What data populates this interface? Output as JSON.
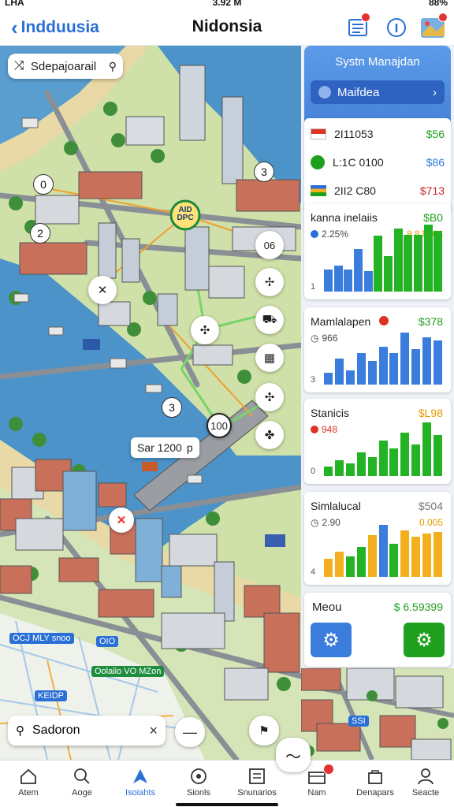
{
  "status_bar": {
    "carrier": "LHA",
    "time": "3.92 M",
    "battery": "88%"
  },
  "header": {
    "back_label": "Indduusia",
    "title": "Nidonsia",
    "notification_count": ""
  },
  "map": {
    "search_chip": "Sdepajoarail",
    "center_marker": "AID DPC",
    "node_labels": [
      "0",
      "2",
      "3",
      "3"
    ],
    "distance_label": "Sar 1200",
    "distance_unit": "p",
    "nodes": {
      "n1": "06",
      "n2": "100"
    },
    "place_labels": [
      "OCJ MLY snoo",
      "OIO",
      "Oolalio VO MZon",
      "KEIDP",
      "SSI"
    ],
    "bottom_search": "Sadoron",
    "bottom_search_clear": "×"
  },
  "panel": {
    "system_title": "Systn Manajdan",
    "system_button": "Maifdea",
    "list": [
      {
        "code": "2I11053",
        "value": "$56",
        "color": "#1ea01e"
      },
      {
        "code": "L:1C 0100",
        "value": "$86",
        "color": "#2a7ad6"
      },
      {
        "code": "2II2 C80",
        "value": "$713",
        "color": "#c62828"
      }
    ],
    "cards": [
      {
        "title": "kanna inelaiis",
        "value": "$B0",
        "sub": "2.25%",
        "sub_value": "8 8J.206",
        "y_label": "1",
        "bars": [
          {
            "v": 0.22,
            "c": "#3b7ddd"
          },
          {
            "v": 0.26,
            "c": "#3b7ddd"
          },
          {
            "v": 0.22,
            "c": "#3b7ddd"
          },
          {
            "v": 0.42,
            "c": "#3b7ddd"
          },
          {
            "v": 0.2,
            "c": "#3b7ddd"
          },
          {
            "v": 0.55,
            "c": "#24b324"
          },
          {
            "v": 0.35,
            "c": "#24b324"
          },
          {
            "v": 0.62,
            "c": "#24b324"
          },
          {
            "v": 0.56,
            "c": "#24b324"
          },
          {
            "v": 0.56,
            "c": "#24b324"
          },
          {
            "v": 0.66,
            "c": "#24b324"
          },
          {
            "v": 0.6,
            "c": "#24b324"
          }
        ]
      },
      {
        "title": "Mamlalapen",
        "value": "$378",
        "sub": "966",
        "sub_value": "",
        "y_label": "3",
        "bars": [
          {
            "v": 0.15,
            "c": "#3b7ddd"
          },
          {
            "v": 0.33,
            "c": "#3b7ddd"
          },
          {
            "v": 0.18,
            "c": "#3b7ddd"
          },
          {
            "v": 0.4,
            "c": "#3b7ddd"
          },
          {
            "v": 0.3,
            "c": "#3b7ddd"
          },
          {
            "v": 0.48,
            "c": "#3b7ddd"
          },
          {
            "v": 0.4,
            "c": "#3b7ddd"
          },
          {
            "v": 0.66,
            "c": "#3b7ddd"
          },
          {
            "v": 0.45,
            "c": "#3b7ddd"
          },
          {
            "v": 0.6,
            "c": "#3b7ddd"
          },
          {
            "v": 0.56,
            "c": "#3b7ddd"
          }
        ]
      },
      {
        "title": "Stanicis",
        "value": "$L98",
        "sub": "948",
        "sub_value": "",
        "y_label": "0",
        "bars": [
          {
            "v": 0.12,
            "c": "#24b324"
          },
          {
            "v": 0.2,
            "c": "#24b324"
          },
          {
            "v": 0.16,
            "c": "#24b324"
          },
          {
            "v": 0.3,
            "c": "#24b324"
          },
          {
            "v": 0.24,
            "c": "#24b324"
          },
          {
            "v": 0.45,
            "c": "#24b324"
          },
          {
            "v": 0.35,
            "c": "#24b324"
          },
          {
            "v": 0.55,
            "c": "#24b324"
          },
          {
            "v": 0.4,
            "c": "#24b324"
          },
          {
            "v": 0.68,
            "c": "#24b324"
          },
          {
            "v": 0.52,
            "c": "#24b324"
          }
        ]
      },
      {
        "title": "Simlalucal",
        "value": "$504",
        "sub": "2.90",
        "sub_value": "0.005",
        "y_label": "4",
        "bars": [
          {
            "v": 0.22,
            "c": "#f2b01e"
          },
          {
            "v": 0.3,
            "c": "#f2b01e"
          },
          {
            "v": 0.25,
            "c": "#24b324"
          },
          {
            "v": 0.36,
            "c": "#24b324"
          },
          {
            "v": 0.5,
            "c": "#f2b01e"
          },
          {
            "v": 0.62,
            "c": "#3b7ddd"
          },
          {
            "v": 0.4,
            "c": "#24b324"
          },
          {
            "v": 0.56,
            "c": "#f2b01e"
          },
          {
            "v": 0.48,
            "c": "#f2b01e"
          },
          {
            "v": 0.52,
            "c": "#f2b01e"
          },
          {
            "v": 0.54,
            "c": "#f2b01e"
          }
        ]
      }
    ],
    "menu": {
      "title": "Meou",
      "value": "$ 6.59399"
    }
  },
  "tabs": [
    {
      "label": "Atem",
      "icon": "home-icon"
    },
    {
      "label": "Aoge",
      "icon": "search-icon"
    },
    {
      "label": "Isoiahts",
      "icon": "location-icon",
      "active": true
    },
    {
      "label": "Sionls",
      "icon": "target-icon"
    },
    {
      "label": "Snunarios",
      "icon": "list-icon"
    },
    {
      "label": "Nam",
      "icon": "briefcase-icon"
    },
    {
      "label": "Denapars",
      "icon": "bag-icon"
    },
    {
      "label": "Seacte",
      "icon": "user-icon"
    }
  ],
  "colors": {
    "accent": "#2a6fd6",
    "water": "#4b93c9",
    "land": "#d8e6b8",
    "green": "#24b324"
  }
}
